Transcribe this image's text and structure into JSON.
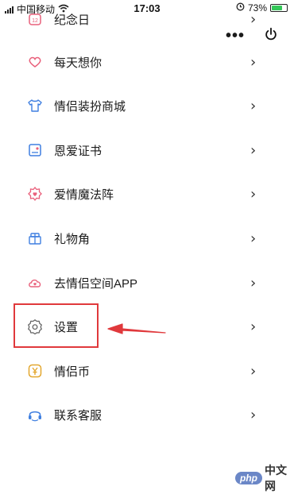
{
  "status_bar": {
    "carrier": "中国移动",
    "time": "17:03",
    "battery": "73%",
    "battery_level": 0.73
  },
  "capsule": {
    "more": "•••",
    "power_icon": "power-icon"
  },
  "menu": {
    "chevron": "›",
    "items": [
      {
        "label": "纪念日",
        "icon": "calendar-icon"
      },
      {
        "label": "每天想你",
        "icon": "heart-icon"
      },
      {
        "label": "情侣装扮商城",
        "icon": "tshirt-icon"
      },
      {
        "label": "恩爱证书",
        "icon": "certificate-icon"
      },
      {
        "label": "爱情魔法阵",
        "icon": "gear-heart-icon"
      },
      {
        "label": "礼物角",
        "icon": "gift-icon"
      },
      {
        "label": "去情侣空间APP",
        "icon": "cloud-heart-icon"
      },
      {
        "label": "设置",
        "icon": "settings-icon"
      },
      {
        "label": "情侣币",
        "icon": "yen-coin-icon"
      },
      {
        "label": "联系客服",
        "icon": "headset-icon"
      }
    ]
  },
  "annotation": {
    "highlight_color": "#e0393c"
  },
  "watermark": {
    "badge": "php",
    "text": "中文网"
  },
  "colors": {
    "icon_pink": "#e9607b",
    "icon_blue": "#3f7fe0",
    "icon_gold": "#e3a72f",
    "icon_gray": "#666666"
  }
}
